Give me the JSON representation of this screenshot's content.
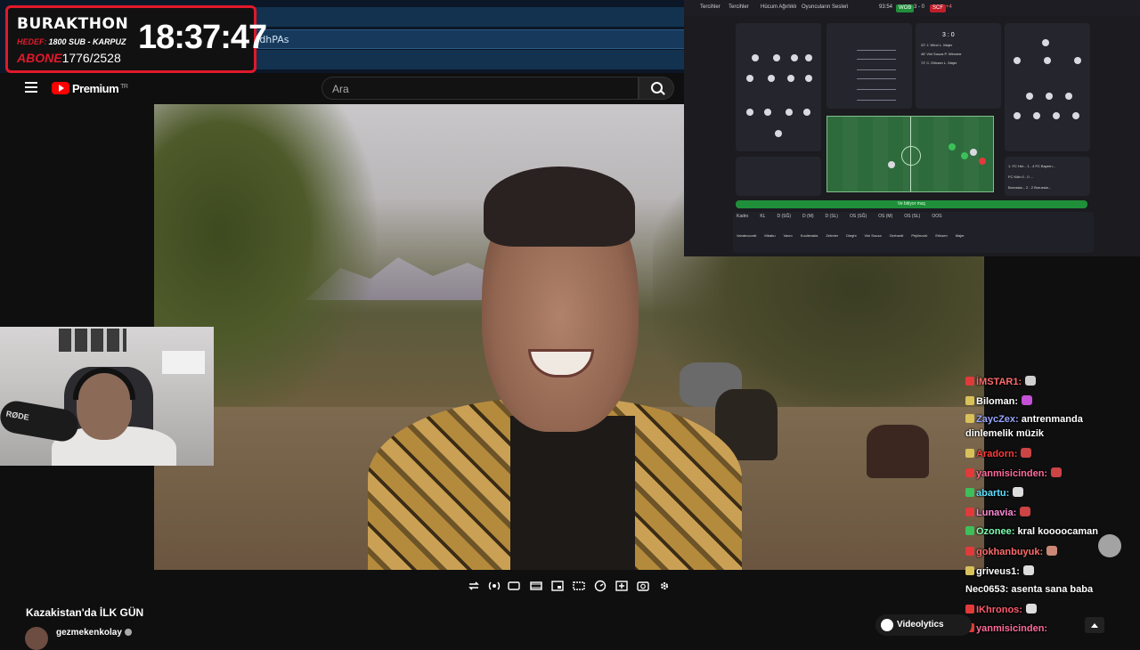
{
  "browser": {
    "url_fragment": "FdhPAs"
  },
  "counter": {
    "brand": "BURAKTHON",
    "goal_label": "HEDEF:",
    "goal_text": "1800 SUB - KARPUZ",
    "subs_label": "ABONE",
    "subs_value": "1776/2528",
    "clock": "18:37:47"
  },
  "youtube": {
    "logo_text": "Premium",
    "logo_region": "TR",
    "search_placeholder": "Ara",
    "video_title": "Kazakistan'da İLK GÜN",
    "channel_name": "gezmekenkolay"
  },
  "fm": {
    "time": "93:54",
    "home": "WOB",
    "score": "3 - 0",
    "away": "SCF",
    "away_extra": "+4",
    "menu": [
      "Tercihler",
      "Tercihler",
      "Hücum Ağırlıklı",
      "Oyuncuların Sesleri"
    ],
    "scoreline_big": "3 : 0",
    "events": [
      "22' J. Wind L. Majer",
      "46' Vini Souza P. Wimmer",
      "72' C. Eriksen L. Majer"
    ],
    "green_bar": "Ve bitiyor maç",
    "other_scores": [
      "1. FC Hei... 1 - 4 FC Bayern...",
      "FC Köln 0 - 0 ...",
      "Borussia... 2 - 2 Borussia..."
    ],
    "bottom_headers": [
      "Kadro",
      "KL",
      "D (SĞ)",
      "D (M)",
      "D (SL)",
      "OS (SĞ)",
      "OS (M)",
      "OS (SL)",
      "OOS"
    ],
    "bottom_players": [
      "Vandevoordt",
      "Mbabu",
      "Vavro",
      "Koulierakis",
      "Zehnter",
      "Dieghi",
      "Vini Souza",
      "Gerhardt",
      "Pejčinović",
      "Eriksen",
      "Majer"
    ]
  },
  "chat": [
    {
      "nick": "İMSTAR1:",
      "color": "#ff6b6b",
      "badge": "#e03a3a",
      "text": "",
      "emote": "#cfcfcf"
    },
    {
      "nick": "Biloman:",
      "color": "#ffffff",
      "badge": "#d9c15a",
      "text": "",
      "emote": "#c451d6"
    },
    {
      "nick": "ZaycZex:",
      "color": "#9aa7ff",
      "badge": "#d9c15a",
      "text": "antrenmanda",
      "emote": ""
    },
    {
      "nick": "",
      "color": "#ffffff",
      "badge": "",
      "text": "dinlemelik müzik",
      "emote": ""
    },
    {
      "nick": "Aradorn:",
      "color": "#ff3b3b",
      "badge": "#d9c15a",
      "text": "",
      "emote": "#c44"
    },
    {
      "nick": "yanmisicinden:",
      "color": "#ff6b9a",
      "badge": "#e03a3a",
      "text": "",
      "emote": "#c44"
    },
    {
      "nick": "abartu:",
      "color": "#5ee0ff",
      "badge": "#3cc05a",
      "text": "",
      "emote": "#ddd"
    },
    {
      "nick": "Lunavia:",
      "color": "#ff8ad6",
      "badge": "#e03a3a",
      "text": "",
      "emote": "#c44"
    },
    {
      "nick": "Ozonee:",
      "color": "#7dffb0",
      "badge": "#3cc05a",
      "text": "kral koooocaman",
      "emote": ""
    },
    {
      "nick": "gokhanbuyuk:",
      "color": "#ff6b6b",
      "badge": "#e03a3a",
      "text": "",
      "emote": "#c87"
    },
    {
      "nick": "griveus1:",
      "color": "#ffffff",
      "badge": "#d9c15a",
      "text": "",
      "emote": "#ddd"
    },
    {
      "nick": "Nec0653:",
      "color": "#ffffff",
      "badge": "",
      "text": "asenta sana baba",
      "emote": ""
    },
    {
      "nick": "IKhronos:",
      "color": "#ff5a6b",
      "badge": "#e03a3a",
      "text": "",
      "emote": "#ddd"
    },
    {
      "nick": "yanmisicinden:",
      "color": "#ff6b9a",
      "badge": "#e03a3a",
      "text": "",
      "emote": ""
    }
  ],
  "overlay": {
    "videolytics": "Videolytics"
  },
  "mic_brand": "RØDE"
}
